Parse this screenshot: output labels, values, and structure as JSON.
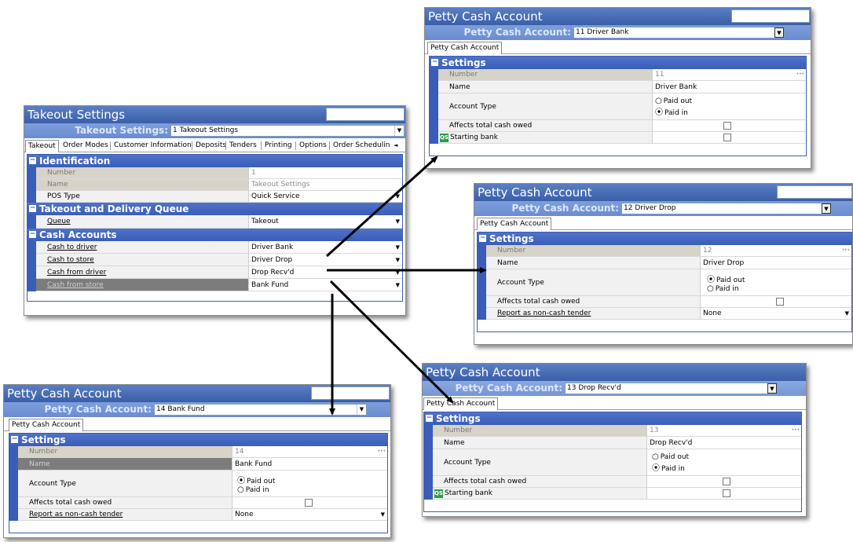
{
  "takeout": {
    "title": "Takeout Settings",
    "selector_label": "Takeout Settings:",
    "selector_value": "1 Takeout Settings",
    "tabs": [
      "Takeout",
      "Order Modes",
      "Customer Information",
      "Deposits",
      "Tenders",
      "Printing",
      "Options",
      "Order Schedulin"
    ],
    "tab_scroll": "◄ ►",
    "sections": {
      "identification": "Identification",
      "queue": "Takeout and Delivery Queue",
      "cash": "Cash Accounts"
    },
    "rows": {
      "number": {
        "label": "Number",
        "value": "1"
      },
      "name": {
        "label": "Name",
        "value": "Takeout Settings"
      },
      "pos_type": {
        "label": "POS Type",
        "value": "Quick Service"
      },
      "queue": {
        "label": "Queue",
        "value": "Takeout"
      },
      "cash_to_driver": {
        "label": "Cash to driver",
        "value": "Driver Bank"
      },
      "cash_to_store": {
        "label": "Cash to store",
        "value": "Driver Drop"
      },
      "cash_from_driver": {
        "label": "Cash from driver",
        "value": "Drop Recv'd"
      },
      "cash_from_store": {
        "label": "Cash from store",
        "value": "Bank Fund"
      }
    }
  },
  "pc11": {
    "title": "Petty Cash Account",
    "selector_label": "Petty Cash Account:",
    "selector_value": "11 Driver Bank",
    "tab": "Petty Cash Account",
    "section": "Settings",
    "number_label": "Number",
    "number_value": "11",
    "name_label": "Name",
    "name_value": "Driver Bank",
    "type_label": "Account Type",
    "paid_out": "Paid out",
    "paid_in": "Paid in",
    "selected": "in",
    "affects_label": "Affects total cash owed",
    "extra_label": "Starting bank"
  },
  "pc12": {
    "title": "Petty Cash Account",
    "selector_label": "Petty Cash Account:",
    "selector_value": "12 Driver Drop",
    "tab": "Petty Cash Account",
    "section": "Settings",
    "number_label": "Number",
    "number_value": "12",
    "name_label": "Name",
    "name_value": "Driver Drop",
    "type_label": "Account Type",
    "paid_out": "Paid out",
    "paid_in": "Paid in",
    "selected": "out",
    "affects_label": "Affects total cash owed",
    "extra_label": "Report as non-cash tender",
    "extra_value": "None"
  },
  "pc13": {
    "title": "Petty Cash Account",
    "selector_label": "Petty Cash Account:",
    "selector_value": "13 Drop Recv'd",
    "tab": "Petty Cash Account",
    "section": "Settings",
    "number_label": "Number",
    "number_value": "13",
    "name_label": "Name",
    "name_value": "Drop Recv'd",
    "type_label": "Account Type",
    "paid_out": "Paid out",
    "paid_in": "Paid in",
    "selected": "in",
    "affects_label": "Affects total cash owed",
    "extra_label": "Starting bank"
  },
  "pc14": {
    "title": "Petty Cash Account",
    "selector_label": "Petty Cash Account:",
    "selector_value": "14 Bank Fund",
    "tab": "Petty Cash Account",
    "section": "Settings",
    "number_label": "Number",
    "number_value": "14",
    "name_label": "Name",
    "name_value": "Bank Fund",
    "type_label": "Account Type",
    "paid_out": "Paid out",
    "paid_in": "Paid in",
    "selected": "out",
    "affects_label": "Affects total cash owed",
    "extra_label": "Report as non-cash tender",
    "extra_value": "None"
  },
  "icons": {
    "qs": "QS",
    "dots": "···",
    "dropdown": "▼",
    "minus": "−",
    "radio_on": "⦿",
    "radio_off": "○"
  }
}
